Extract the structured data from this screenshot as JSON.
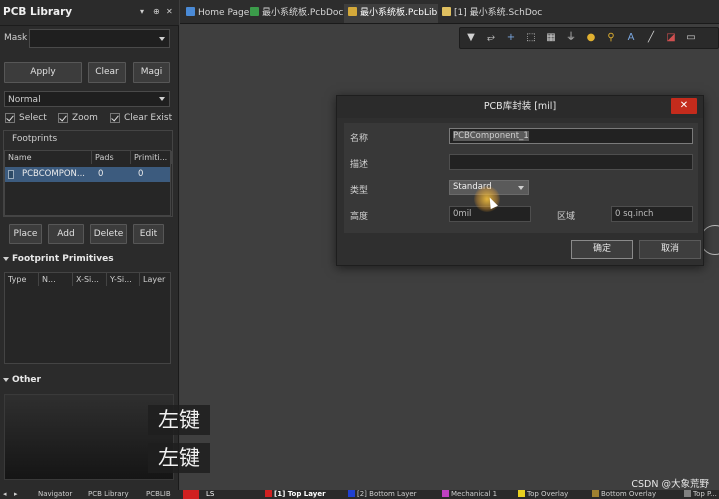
{
  "panel": {
    "title": "PCB Library",
    "controls": [
      "▾",
      "⊕",
      "✕"
    ],
    "mask_label": "Mask",
    "mask_value": "",
    "buttons": {
      "apply": "Apply",
      "clear": "Clear",
      "magnify": "Magi"
    },
    "mode": "Normal",
    "checkboxes": {
      "select": "Select",
      "zoom": "Zoom",
      "clear_existing": "Clear Exist"
    },
    "footprints": {
      "title": "Footprints",
      "columns": [
        "Name",
        "Pads",
        "Primiti..."
      ],
      "rows": [
        {
          "name": "PCBCOMPON...",
          "pads": "0",
          "primitives": "0"
        }
      ]
    },
    "actions": {
      "place": "Place",
      "add": "Add",
      "delete": "Delete",
      "edit": "Edit"
    },
    "primitives": {
      "title": "Footprint Primitives",
      "columns": [
        "Type",
        "N...",
        "X-Si...",
        "Y-Si...",
        "Layer"
      ]
    },
    "other": {
      "title": "Other"
    }
  },
  "tabs": [
    {
      "label": "Home Page",
      "icon": "home-icon",
      "active": false,
      "color": "#4a8ad6"
    },
    {
      "label": "最小系统板.PcbDoc",
      "icon": "pcbdoc-icon",
      "active": false,
      "color": "#3b9b4a"
    },
    {
      "label": "最小系统板.PcbLib",
      "icon": "pcblib-icon",
      "active": true,
      "color": "#d4a93a"
    },
    {
      "label": "[1] 最小系统.SchDoc",
      "icon": "schdoc-icon",
      "active": false,
      "color": "#e0c060"
    }
  ],
  "toolbar": {
    "tools": [
      "filter-icon",
      "route-icon",
      "plus-icon",
      "rect-select-icon",
      "grid-icon",
      "route-tool-icon",
      "pad-icon",
      "via-icon",
      "text-icon",
      "line-icon",
      "shape-icon",
      "region-icon"
    ],
    "glyphs": [
      "▼",
      "⥂",
      "+",
      "⬚",
      "▦",
      "⏚",
      "●",
      "⚲",
      "A",
      "╱",
      "◪",
      "▭"
    ]
  },
  "dialog": {
    "title": "PCB库封装 [mil]",
    "close_glyph": "✕",
    "name_label": "名称",
    "name_value": "PCBComponent_1",
    "desc_label": "描述",
    "desc_value": "",
    "type_label": "类型",
    "type_value": "Standard",
    "height_label": "高度",
    "height_value": "0mil",
    "area_label": "区域",
    "area_value": "0 sq.inch",
    "ok": "确定",
    "cancel": "取消"
  },
  "overlay": [
    "左键",
    "左键"
  ],
  "statusbar": {
    "nav": [
      "◂",
      "▸"
    ],
    "items": [
      "Navigator",
      "PCB Library",
      "PCBLIB"
    ],
    "layer_ls": "LS",
    "layers": [
      {
        "label": "[1] Top Layer",
        "color": "#d02020"
      },
      {
        "label": "[2] Bottom Layer",
        "color": "#2040d0"
      },
      {
        "label": "Mechanical 1",
        "color": "#c040c0"
      },
      {
        "label": "Top Overlay",
        "color": "#e8d020"
      },
      {
        "label": "Bottom Overlay",
        "color": "#a08030"
      },
      {
        "label": "Top P...",
        "color": "#808080"
      }
    ]
  },
  "watermark": "CSDN @大象荒野"
}
